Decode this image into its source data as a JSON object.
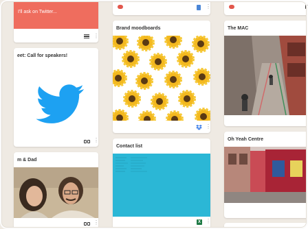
{
  "cards": {
    "twitter_note": {
      "text": "I'll ask on Twitter..."
    },
    "tweet": {
      "title": "eet: Call for speakers!"
    },
    "dad": {
      "title": "m & Dad"
    },
    "moodboards": {
      "title": "Brand moodboards"
    },
    "contact_list": {
      "title": "Contact list"
    },
    "the_mac": {
      "title": "The MAC"
    },
    "oh_yeah": {
      "title": "Oh Yeah Centre"
    }
  },
  "icons": {
    "red_dot": "pin-icon",
    "doc": "google-docs-icon",
    "list": "list-icon",
    "link": "link-icon",
    "dropbox": "dropbox-icon",
    "excel": "excel-icon"
  },
  "colors": {
    "twitter_note_bg": "#ef6d5e",
    "twitter_blue": "#1da1f2",
    "contact_cyan": "#2bb7d6",
    "board_bg": "#efeae3"
  }
}
